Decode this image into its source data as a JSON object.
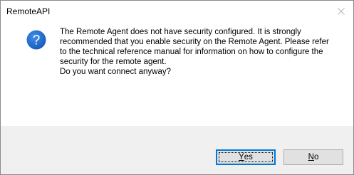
{
  "window": {
    "title": "RemoteAPI",
    "close_icon": "close-icon"
  },
  "message": {
    "icon": "question-icon",
    "body": "The Remote Agent does not have security configured. It is strongly recommended that you enable security on the Remote Agent. Please refer to the technical reference manual for information on how to configure the security for the remote agent.",
    "question": "Do you want connect anyway?"
  },
  "buttons": {
    "yes": {
      "mnemonic": "Y",
      "rest": "es"
    },
    "no": {
      "mnemonic": "N",
      "rest": "o"
    }
  },
  "colors": {
    "icon_blue": "#1c6dd0",
    "footer_bg": "#f0f0f0",
    "button_bg": "#e1e1e1",
    "default_button_border": "#0078d7"
  }
}
